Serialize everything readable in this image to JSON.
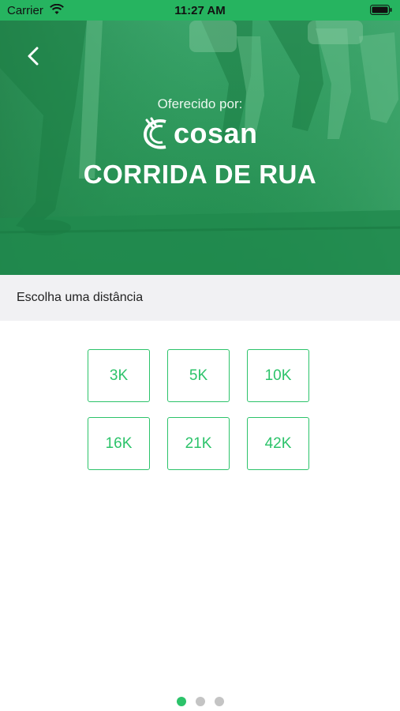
{
  "status_bar": {
    "carrier": "Carrier",
    "time": "11:27 AM",
    "wifi_icon": "wifi-icon",
    "battery_icon": "battery-icon"
  },
  "header": {
    "back_icon": "chevron-left-icon",
    "offered_by": "Oferecido por:",
    "sponsor": "cosan",
    "title": "CORRIDA DE RUA"
  },
  "section": {
    "label": "Escolha uma distância"
  },
  "distances": [
    "3K",
    "5K",
    "10K",
    "16K",
    "21K",
    "42K"
  ],
  "pager": {
    "count": 3,
    "active_index": 0
  },
  "colors": {
    "accent": "#2cc36a",
    "status_bar": "#26b460",
    "hero_overlay": "#2a9457",
    "section_bg": "#f1f1f3"
  }
}
